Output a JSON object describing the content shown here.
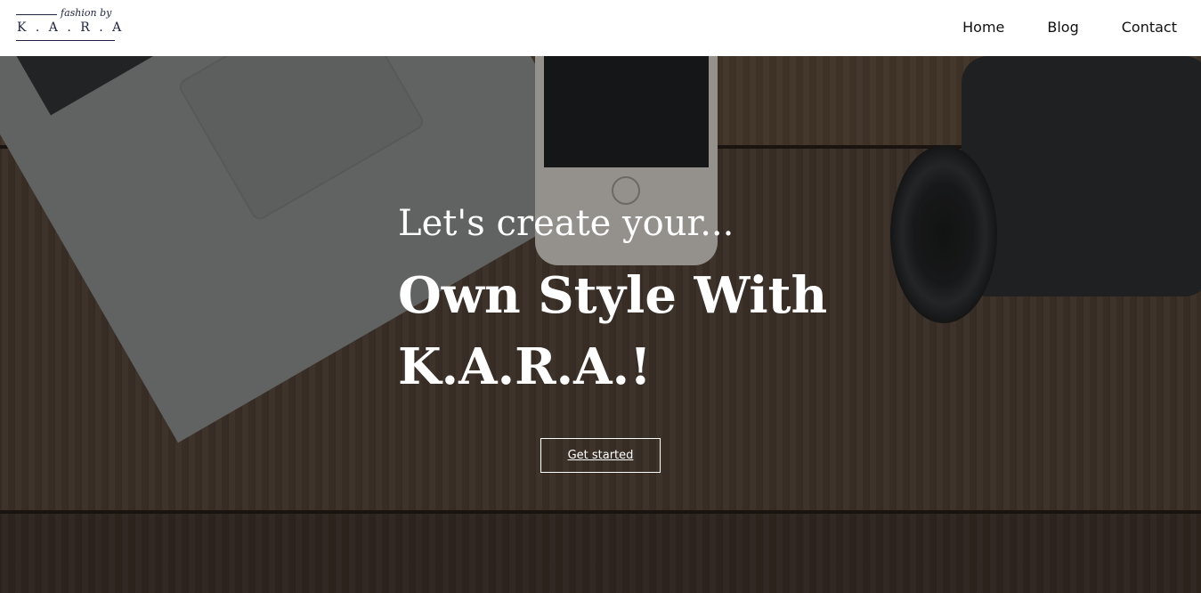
{
  "brand": {
    "script": "fashion by",
    "name": "K.A.R.A",
    "name_spaced": "K . A . R . A"
  },
  "nav": {
    "items": [
      {
        "label": "Home"
      },
      {
        "label": "Blog"
      },
      {
        "label": "Contact"
      }
    ]
  },
  "hero": {
    "kicker": "Let's create your...",
    "title": "Own Style With K.A.R.A.!",
    "cta_label": "Get started"
  },
  "colors": {
    "brand_navy": "#1d2340",
    "overlay": "#14100e",
    "text_light": "#ffffff"
  }
}
